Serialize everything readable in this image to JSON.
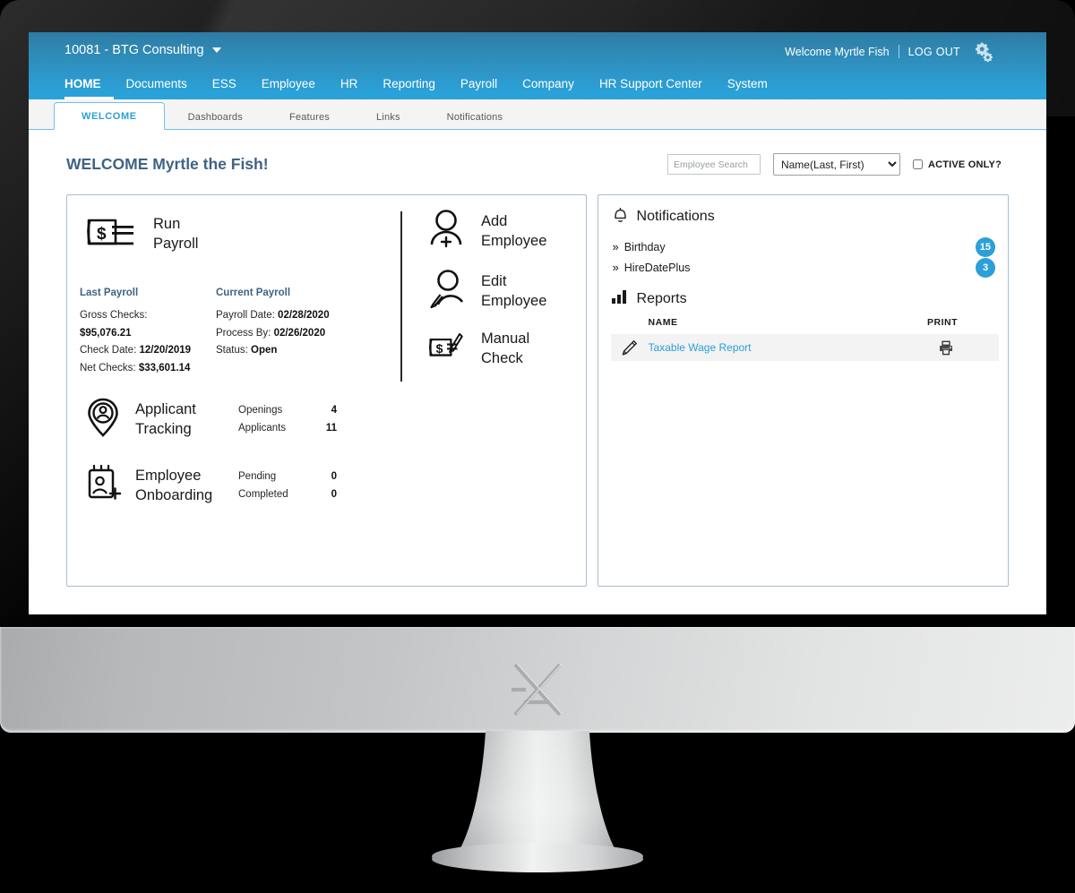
{
  "header": {
    "company": "10081 - BTG Consulting",
    "welcome_user": "Welcome Myrtle Fish",
    "logout": "LOG OUT",
    "gear_icon": "gear-icon",
    "caret_icon": "chevron-down-icon",
    "nav": [
      {
        "label": "HOME",
        "active": true
      },
      {
        "label": "Documents",
        "active": false
      },
      {
        "label": "ESS",
        "active": false
      },
      {
        "label": "Employee",
        "active": false
      },
      {
        "label": "HR",
        "active": false
      },
      {
        "label": "Reporting",
        "active": false
      },
      {
        "label": "Payroll",
        "active": false
      },
      {
        "label": "Company",
        "active": false
      },
      {
        "label": "HR Support Center",
        "active": false
      },
      {
        "label": "System",
        "active": false
      }
    ]
  },
  "tabs": [
    {
      "label": "WELCOME",
      "active": true
    },
    {
      "label": "Dashboards",
      "active": false
    },
    {
      "label": "Features",
      "active": false
    },
    {
      "label": "Links",
      "active": false
    },
    {
      "label": "Notifications",
      "active": false
    }
  ],
  "page": {
    "title": "WELCOME Myrtle the Fish!"
  },
  "search": {
    "placeholder": "Employee Search",
    "value": "",
    "select_value": "Name(Last, First)",
    "select_options": [
      "Name(Last, First)"
    ],
    "active_only_label": "ACTIVE ONLY?",
    "active_only_checked": false
  },
  "payroll": {
    "title_line1": "Run",
    "title_line2": "Payroll",
    "icon": "check-dollar-icon",
    "last": {
      "heading": "Last Payroll",
      "gross_label": "Gross Checks:",
      "gross_value": "$95,076.21",
      "check_date_label": "Check Date:",
      "check_date_value": "12/20/2019",
      "net_label": "Net Checks:",
      "net_value": "$33,601.14"
    },
    "current": {
      "heading": "Current Payroll",
      "payroll_date_label": "Payroll Date:",
      "payroll_date_value": "02/28/2020",
      "process_by_label": "Process By:",
      "process_by_value": "02/26/2020",
      "status_label": "Status:",
      "status_value": "Open"
    }
  },
  "applicant_tracking": {
    "title_line1": "Applicant",
    "title_line2": "Tracking",
    "icon": "location-pin-person-icon",
    "stats": [
      {
        "label": "Openings",
        "value": "4"
      },
      {
        "label": "Applicants",
        "value": "11"
      }
    ]
  },
  "onboarding": {
    "title_line1": "Employee",
    "title_line2": "Onboarding",
    "icon": "badge-person-add-icon",
    "stats": [
      {
        "label": "Pending",
        "value": "0"
      },
      {
        "label": "Completed",
        "value": "0"
      }
    ]
  },
  "actions": [
    {
      "line1": "Add",
      "line2": "Employee",
      "icon": "person-add-icon"
    },
    {
      "line1": "Edit",
      "line2": "Employee",
      "icon": "person-edit-icon"
    },
    {
      "line1": "Manual",
      "line2": "Check",
      "icon": "check-edit-icon"
    }
  ],
  "notifications": {
    "heading": "Notifications",
    "icon": "bell-icon",
    "items": [
      {
        "label": "Birthday",
        "count": "15"
      },
      {
        "label": "HireDatePlus",
        "count": "3"
      }
    ]
  },
  "reports": {
    "heading": "Reports",
    "icon": "bar-chart-icon",
    "columns": {
      "name": "NAME",
      "print": "PRINT"
    },
    "rows": [
      {
        "edit_icon": "pencil-icon",
        "name": "Taxable Wage Report",
        "print_icon": "printer-icon"
      }
    ]
  },
  "colors": {
    "header_blue": "#2ba0d6",
    "title_blue": "#3f6384",
    "link_blue": "#2ba0d6",
    "badge_blue": "#2ba0d6",
    "panel_border": "#a9bed1"
  },
  "monitor": {
    "brand_logo": "x-logo-icon"
  }
}
